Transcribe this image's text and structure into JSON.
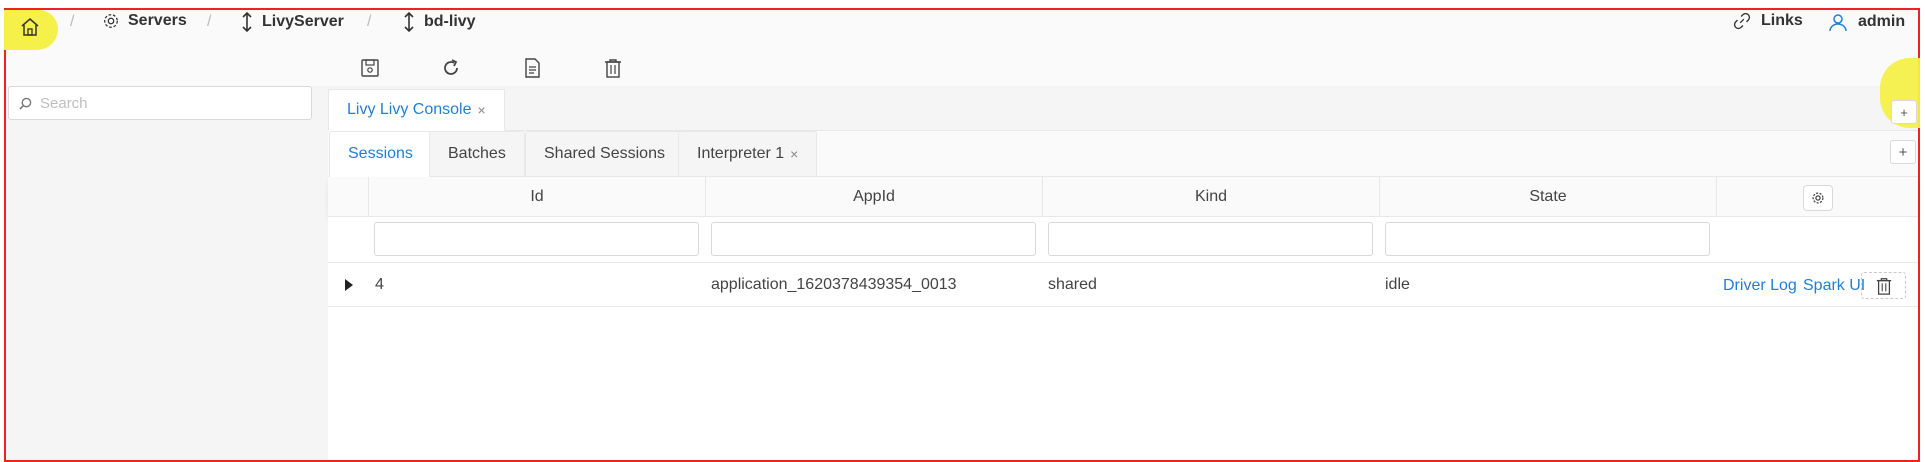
{
  "breadcrumb": {
    "home_icon": "home-icon",
    "separator": "/",
    "items": [
      {
        "label": "Servers",
        "icon": "gear-icon"
      },
      {
        "label": "LivyServer",
        "icon": "arrows-updown-icon"
      },
      {
        "label": "bd-livy",
        "icon": "arrows-updown-icon"
      }
    ]
  },
  "header_right": {
    "links_label": "Links",
    "user_label": "admin"
  },
  "toolbar": {
    "buttons": [
      "save-icon",
      "refresh-icon",
      "document-icon",
      "trash-icon"
    ]
  },
  "sidebar": {
    "search_placeholder": "Search"
  },
  "console_tabs": [
    {
      "label": "Livy Livy Console",
      "close": "×"
    }
  ],
  "console_add": "+",
  "inner_tabs": [
    {
      "label": "Sessions",
      "active": true
    },
    {
      "label": "Batches"
    },
    {
      "label": "Shared Sessions"
    },
    {
      "label": "Interpreter 1",
      "close": "×"
    }
  ],
  "inner_add": "+",
  "table": {
    "columns": [
      "Id",
      "AppId",
      "Kind",
      "State"
    ],
    "rows": [
      {
        "id": "4",
        "appid": "application_1620378439354_0013",
        "kind": "shared",
        "state": "idle",
        "link_driver_log": "Driver Log",
        "link_spark_ui": "Spark UI"
      }
    ]
  },
  "colors": {
    "accent": "#1f7fd6",
    "highlight": "#f6f04a",
    "frame": "#e22222"
  }
}
